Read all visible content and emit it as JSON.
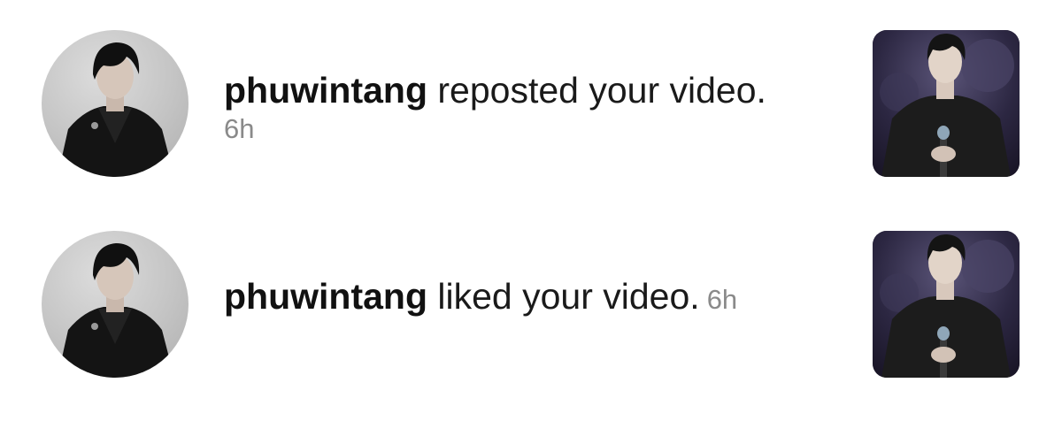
{
  "notifications": [
    {
      "username": "phuwintang",
      "action": " reposted your video.",
      "time": "6h",
      "avatar_icon": "user-avatar-photo",
      "thumbnail_icon": "video-thumbnail-photo"
    },
    {
      "username": "phuwintang",
      "action": " liked your video.",
      "time": "6h",
      "avatar_icon": "user-avatar-photo",
      "thumbnail_icon": "video-thumbnail-photo"
    }
  ],
  "colors": {
    "username": "#111111",
    "action": "#1a1a1a",
    "timestamp": "#8a8a8a",
    "background": "#ffffff"
  }
}
